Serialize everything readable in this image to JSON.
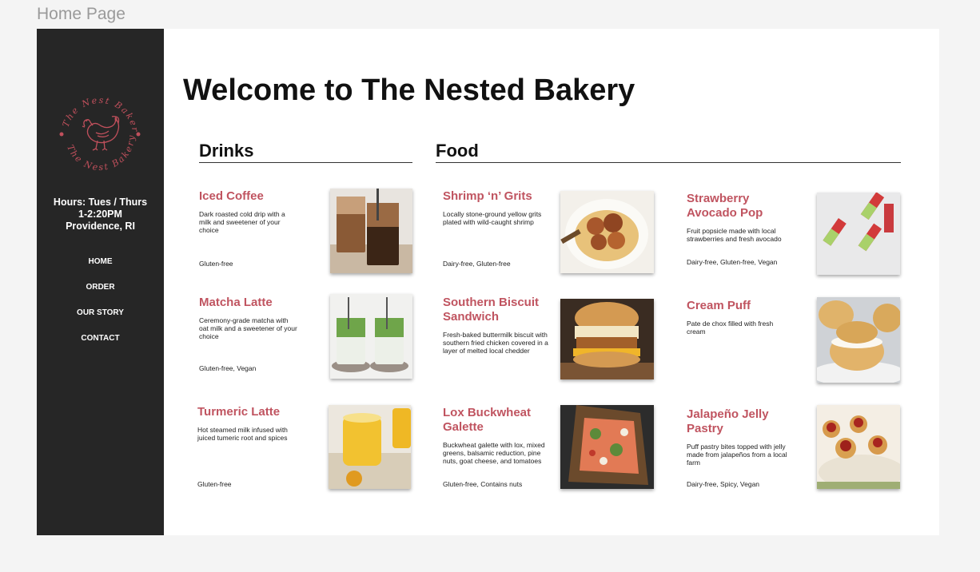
{
  "frame_label": "Home Page",
  "sidebar": {
    "logo_text_top": "The Nest Bakery",
    "logo_text_bottom": "The Nest Bakery",
    "hours_line1": "Hours: Tues / Thurs",
    "hours_line2": "1-2:20PM",
    "location": "Providence, RI",
    "nav": [
      {
        "label": "HOME"
      },
      {
        "label": "ORDER"
      },
      {
        "label": "OUR STORY"
      },
      {
        "label": "CONTACT"
      }
    ]
  },
  "main": {
    "title": "Welcome to The Nested Bakery",
    "drinks_heading": "Drinks",
    "food_heading": "Food",
    "drinks": [
      {
        "name": "Iced Coffee",
        "desc": "Dark roasted cold drip with a milk and sweetener of your choice",
        "tags": "Gluten-free",
        "photo_icon": "iced-coffee"
      },
      {
        "name": "Matcha Latte",
        "desc": "Ceremony-grade matcha with oat milk and a sweetener of your choice",
        "tags": "Gluten-free, Vegan",
        "photo_icon": "matcha-latte"
      },
      {
        "name": "Turmeric Latte",
        "desc": "Hot steamed milk infused with juiced tumeric root and spices",
        "tags": "Gluten-free",
        "photo_icon": "turmeric-latte"
      }
    ],
    "food_left": [
      {
        "name": "Shrimp ‘n’ Grits",
        "desc": "Locally stone-ground yellow grits plated with wild-caught shrimp",
        "tags": "Dairy-free, Gluten-free",
        "photo_icon": "shrimp-grits"
      },
      {
        "name": "Southern Biscuit Sandwich",
        "desc": "Fresh-baked buttermilk biscuit with southern fried chicken covered in a layer of melted local chedder",
        "tags": "",
        "photo_icon": "biscuit-sandwich"
      },
      {
        "name": "Lox Buckwheat Galette",
        "desc": "Buckwheat galette with lox, mixed greens, balsamic reduction, pine nuts, goat cheese, and tomatoes",
        "tags": "Gluten-free, Contains nuts",
        "photo_icon": "lox-galette"
      }
    ],
    "food_right": [
      {
        "name": "Strawberry Avocado Pop",
        "desc": "Fruit popsicle made with local strawberries and fresh avocado",
        "tags": "Dairy-free, Gluten-free, Vegan",
        "photo_icon": "strawberry-pop"
      },
      {
        "name": "Cream Puff",
        "desc": "Pate de chox filled with fresh cream",
        "tags": "",
        "photo_icon": "cream-puff"
      },
      {
        "name": "Jalapeño Jelly Pastry",
        "desc": "Puff pastry bites topped with jelly made from jalapeños from a local farm",
        "tags": "Dairy-free, Spicy, Vegan",
        "photo_icon": "jelly-pastry"
      }
    ]
  },
  "colors": {
    "sidebar_bg": "#262626",
    "accent": "#c05460",
    "logo": "#c0505c"
  }
}
